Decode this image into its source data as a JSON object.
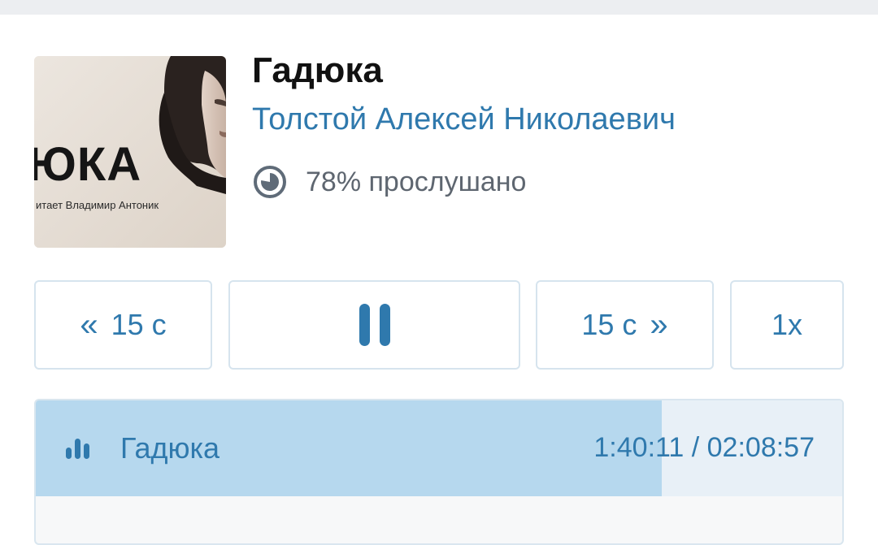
{
  "book": {
    "title": "Гадюка",
    "author": "Толстой Алексей Николаевич",
    "progress_text": "78% прослушано",
    "progress_fraction": 0.78,
    "cover": {
      "title_text": "ЮКА",
      "subtitle_text": "итает Владимир Антоник"
    }
  },
  "controls": {
    "back_label": "15 с",
    "forward_label": "15 с",
    "speed_label": "1x",
    "back_icon": "double-chevron-left-icon",
    "forward_icon": "double-chevron-right-icon",
    "play_icon": "pause-icon"
  },
  "chapter": {
    "name": "Гадюка",
    "time": "1:40:11 / 02:08:57",
    "position_fraction": 0.776,
    "icon": "playing-bars-icon"
  },
  "colors": {
    "accent": "#2f79ad",
    "progress_fill": "#b6d8ee",
    "progress_track": "#e8f0f7",
    "pie": "#5f6b78"
  }
}
